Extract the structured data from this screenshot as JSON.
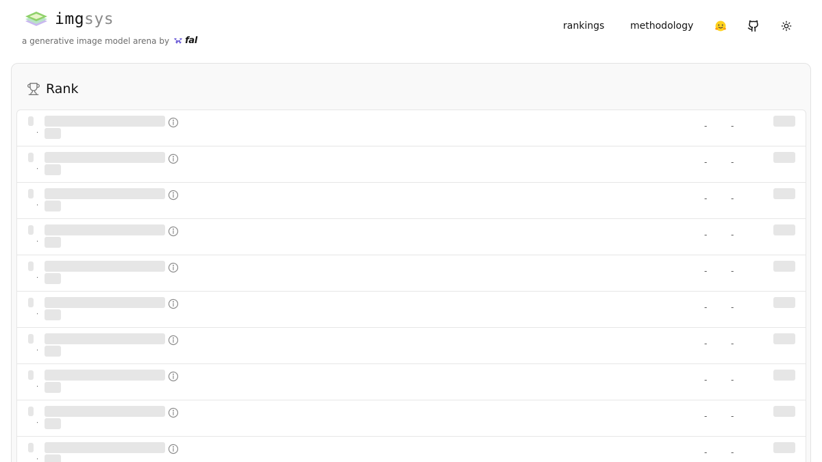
{
  "header": {
    "brand_part1": "img",
    "brand_part2": "sys",
    "tagline": "a generative image model arena by",
    "partner": "fal",
    "nav": [
      {
        "label": "rankings"
      },
      {
        "label": "methodology"
      }
    ],
    "icons": [
      "huggingface-icon",
      "github-icon",
      "theme-toggle-sun-icon"
    ]
  },
  "card": {
    "title": "Rank",
    "title_icon": "trophy-icon"
  },
  "rows": [
    {
      "dot": ".",
      "dash1": "-",
      "dash2": "-"
    },
    {
      "dot": ".",
      "dash1": "-",
      "dash2": "-"
    },
    {
      "dot": ".",
      "dash1": "-",
      "dash2": "-"
    },
    {
      "dot": ".",
      "dash1": "-",
      "dash2": "-"
    },
    {
      "dot": ".",
      "dash1": "-",
      "dash2": "-"
    },
    {
      "dot": ".",
      "dash1": "-",
      "dash2": "-"
    },
    {
      "dot": ".",
      "dash1": "-",
      "dash2": "-"
    },
    {
      "dot": ".",
      "dash1": "-",
      "dash2": "-"
    },
    {
      "dot": ".",
      "dash1": "-",
      "dash2": "-"
    },
    {
      "dot": ".",
      "dash1": "-",
      "dash2": "-"
    }
  ],
  "colors": {
    "skeleton": "#e6e6e6",
    "border": "#e3e3e3",
    "card_bg": "#f9f9f9",
    "brand_muted": "#8a8a8a",
    "huggingface": "#FFD21E",
    "fal_accent": "#6B5BD6"
  }
}
